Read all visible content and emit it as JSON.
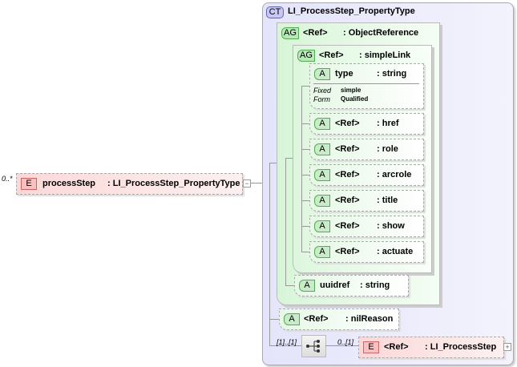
{
  "root": {
    "multiplicity": "0..*",
    "badge": "E",
    "name": "processStep",
    "type": ": LI_ProcessStep_PropertyType",
    "collapse": "−"
  },
  "complex_type": {
    "badge": "CT",
    "name": "LI_ProcessStep_PropertyType"
  },
  "object_reference": {
    "badge": "AG",
    "name": "<Ref>",
    "type": ": ObjectReference"
  },
  "simple_link": {
    "badge": "AG",
    "name": "<Ref>",
    "type": ": simpleLink"
  },
  "type_attr": {
    "badge": "A",
    "name": "type",
    "type": ": string",
    "fixed_label": "Fixed",
    "fixed_value": "simple",
    "form_label": "Form",
    "form_value": "Qualified"
  },
  "link_attrs": [
    {
      "badge": "A",
      "name": "<Ref>",
      "type": ": href"
    },
    {
      "badge": "A",
      "name": "<Ref>",
      "type": ": role"
    },
    {
      "badge": "A",
      "name": "<Ref>",
      "type": ": arcrole"
    },
    {
      "badge": "A",
      "name": "<Ref>",
      "type": ": title"
    },
    {
      "badge": "A",
      "name": "<Ref>",
      "type": ": show"
    },
    {
      "badge": "A",
      "name": "<Ref>",
      "type": ": actuate"
    }
  ],
  "uuidref": {
    "badge": "A",
    "name": "uuidref",
    "type": ": string"
  },
  "nil_reason": {
    "badge": "A",
    "name": "<Ref>",
    "type": ": nilReason"
  },
  "sequence": {
    "multiplicity": "[1]..[1]"
  },
  "process_step_ref": {
    "multiplicity": "0..[1]",
    "badge": "E",
    "name": "<Ref>",
    "type": ": LI_ProcessStep",
    "expand": "+"
  }
}
